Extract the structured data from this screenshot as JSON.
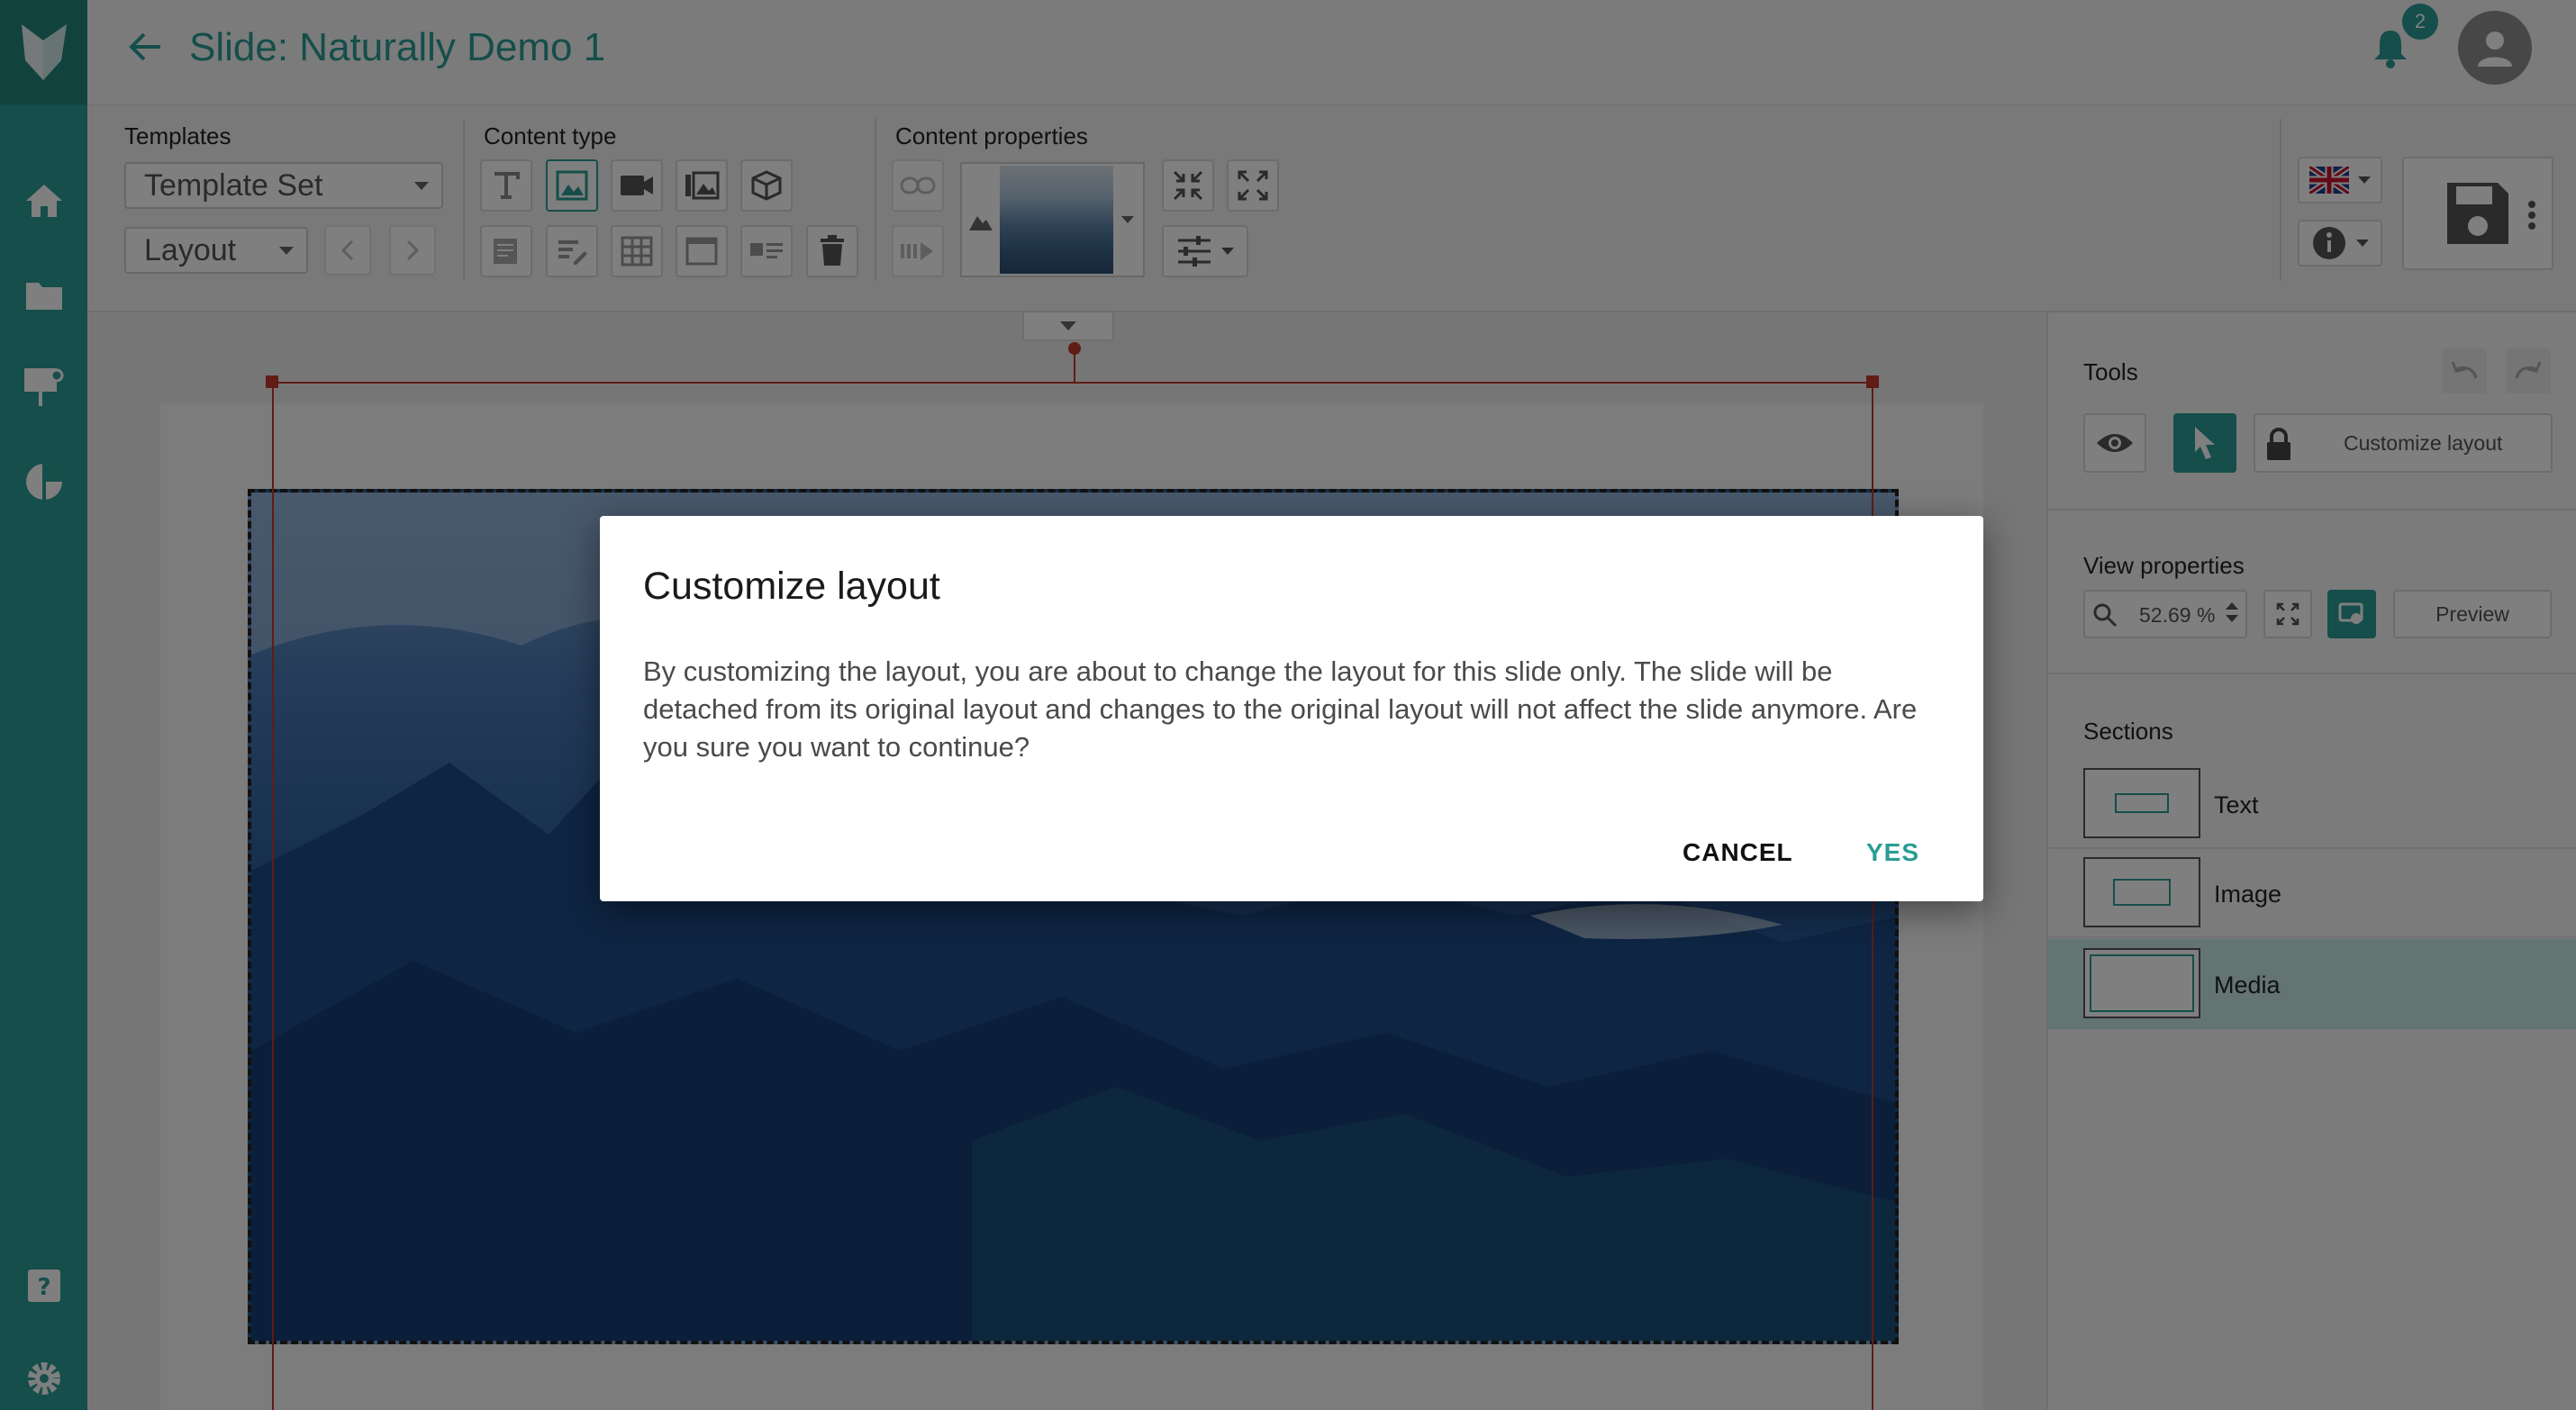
{
  "header": {
    "title": "Slide: Naturally Demo 1",
    "notification_count": "2"
  },
  "toolbar": {
    "templates_label": "Templates",
    "template_set_value": "Template Set",
    "layout_value": "Layout",
    "content_type_label": "Content type",
    "content_properties_label": "Content properties"
  },
  "right_panel": {
    "tools_label": "Tools",
    "customize_layout_label": "Customize layout",
    "view_properties_label": "View properties",
    "zoom_value": "52.69 %",
    "preview_label": "Preview",
    "sections_label": "Sections",
    "sections": [
      {
        "name": "Text"
      },
      {
        "name": "Image"
      },
      {
        "name": "Media"
      }
    ]
  },
  "dialog": {
    "title": "Customize layout",
    "body": "By customizing the layout, you are about to change the layout for this slide only. The slide will be detached from its original layout and changes to the original layout will not affect the slide anymore. Are you sure you want to continue?",
    "cancel_label": "CANCEL",
    "yes_label": "YES"
  },
  "colors": {
    "brand": "#2a9d94",
    "selection_red": "#c0392b"
  },
  "icons": {
    "left_nav": [
      "home-icon",
      "folder-icon",
      "presentation-icon",
      "chart-pie-icon",
      "help-icon",
      "settings-icon"
    ]
  }
}
